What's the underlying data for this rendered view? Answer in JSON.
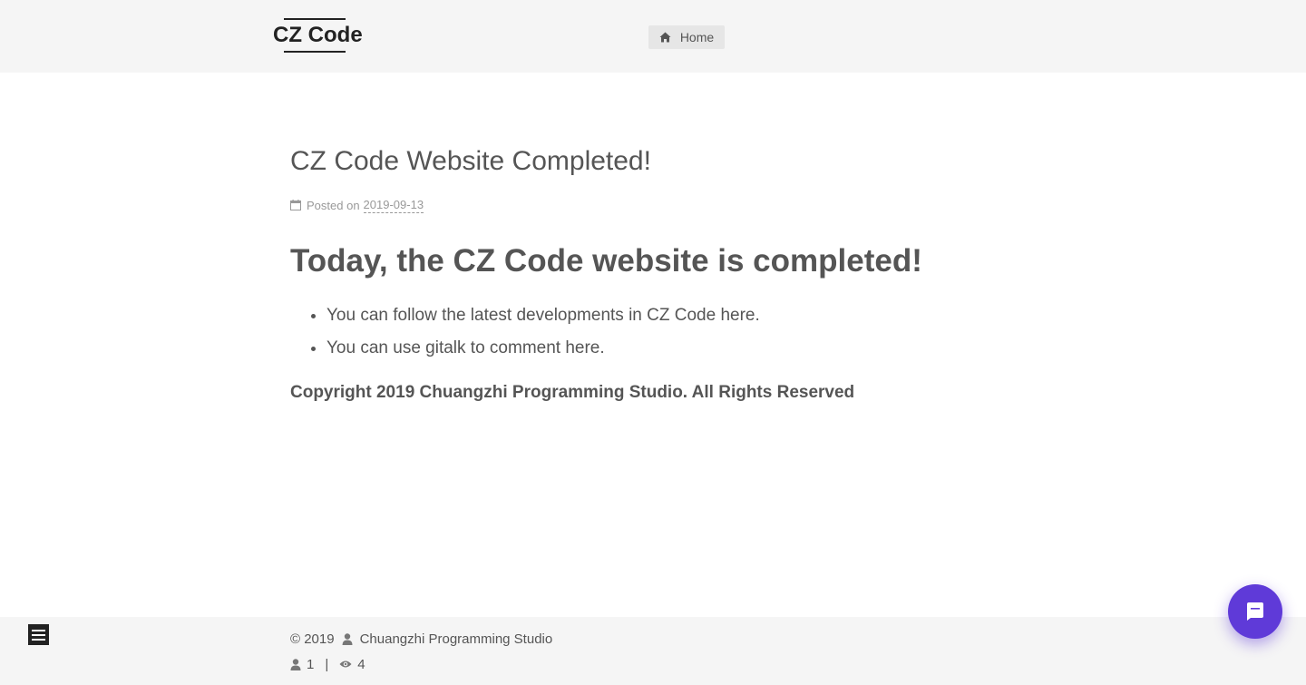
{
  "header": {
    "brand": "CZ Code",
    "nav": {
      "home_label": "Home",
      "home_icon": "home-icon"
    }
  },
  "post": {
    "title": "CZ Code Website Completed!",
    "meta": {
      "posted_on_label": "Posted on",
      "date": "2019-09-13",
      "icon": "calendar-icon"
    },
    "heading": "Today, the CZ Code website is completed!",
    "list": [
      "You can follow the latest developments in CZ Code here.",
      "You can use gitalk to comment here."
    ],
    "copyright": "Copyright 2019 Chuangzhi Programming Studio. All Rights Reserved"
  },
  "footer": {
    "copyright_year": "© 2019",
    "author": "Chuangzhi Programming Studio",
    "visitors": "1",
    "separator": "|",
    "views": "4"
  },
  "colors": {
    "header_bg": "#f5f5f5",
    "text": "#555555",
    "chat_accent": "#5f3ad8"
  }
}
